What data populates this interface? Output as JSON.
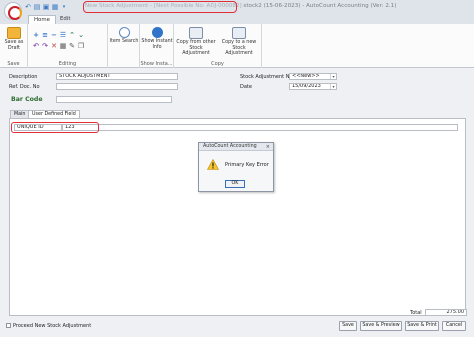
{
  "window": {
    "title_highlighted": "New Stock Adjustment - [Next Possible No: ADJ-000082]",
    "title_rest": " stock2 (15-06-2023) - AutoCount Accounting (Ver: 2.1)"
  },
  "menu_tabs": [
    "Home",
    "Edit"
  ],
  "ribbon": {
    "save_as_draft": "Save as Draft",
    "item_search": "Item Search",
    "show_instant_info": "Show Instant Info",
    "copy_from_other": "Copy from other Stock Adjustment",
    "copy_to_new": "Copy to a new Stock Adjustment",
    "groups": [
      "Save",
      "Editing",
      "Show Insta...",
      "Copy"
    ]
  },
  "form": {
    "description_label": "Description",
    "description_value": "STOCK ADJUSTMENT",
    "ref_doc_label": "Ref. Doc. No",
    "ref_doc_value": "",
    "adjustment_no_label": "Stock Adjustment No",
    "adjustment_no_value": "<<New>>",
    "date_label": "Date",
    "date_value": "15/09/2023",
    "barcode_label": "Bar Code",
    "barcode_value": ""
  },
  "form_tabs": [
    "Main",
    "User Defined Field"
  ],
  "udf": {
    "label": "UNIQUE ID",
    "value": "123"
  },
  "dialog": {
    "title": "AutoCount Accounting",
    "close": "×",
    "message": "Primary Key Error",
    "ok": "OK"
  },
  "footer": {
    "total_label": "Total",
    "total_value": "275.00",
    "proceed_label": "Proceed New Stock Adjustment",
    "save": "Save",
    "save_preview": "Save & Preview",
    "save_print": "Save & Print",
    "cancel": "Cancel"
  },
  "colors": {
    "highlight_ring": "#e0303a",
    "barcode_label": "#2d6b2f",
    "accent_blue": "#3a78c6"
  }
}
